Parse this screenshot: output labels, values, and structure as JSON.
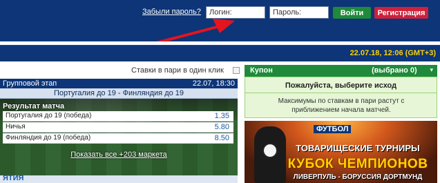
{
  "header": {
    "forgot_label": "Забыли пароль?",
    "login_placeholder": "Логин:",
    "password_placeholder": "Пароль:",
    "login_button": "Войти",
    "register_button": "Регистрация",
    "colors": {
      "background": "#0d3577",
      "login": "#1f8a3a",
      "register": "#d0203a",
      "arrow": "#e5141f"
    }
  },
  "datebar": {
    "datetime": "22.07.18, 12:06 (GMT+3)"
  },
  "oneclick": {
    "label": "Ставки в пари в один клик"
  },
  "event": {
    "stage": "Групповой этап",
    "time": "22.07, 18:30",
    "teams": "Португалия до 19  -  Финляндия до 19",
    "market_title": "Результат матча",
    "outcomes": [
      {
        "label": "Португалия до 19 (победа)",
        "odds": "1.35"
      },
      {
        "label": "Ничья",
        "odds": "5.80"
      },
      {
        "label": "Финляндия до 19 (победа)",
        "odds": "8.50"
      }
    ],
    "show_more": "Показать все +203 маркета",
    "bottom_label": "ЯТИЯ"
  },
  "coupon": {
    "title": "Купон",
    "count": "(выбрано 0)",
    "caret": "▾",
    "prompt": "Пожалуйста, выберите исход",
    "note": "Максимумы по ставкам в пари растут с приближением начала матчей."
  },
  "banner": {
    "sport": "ФУТБОЛ",
    "line1": "ТОВАРИЩЕСКИЕ ТУРНИРЫ",
    "line2": "КУБОК ЧЕМПИОНОВ",
    "line3": "ЛИВЕРПУЛЬ - БОРУССИЯ ДОРТМУНД"
  }
}
